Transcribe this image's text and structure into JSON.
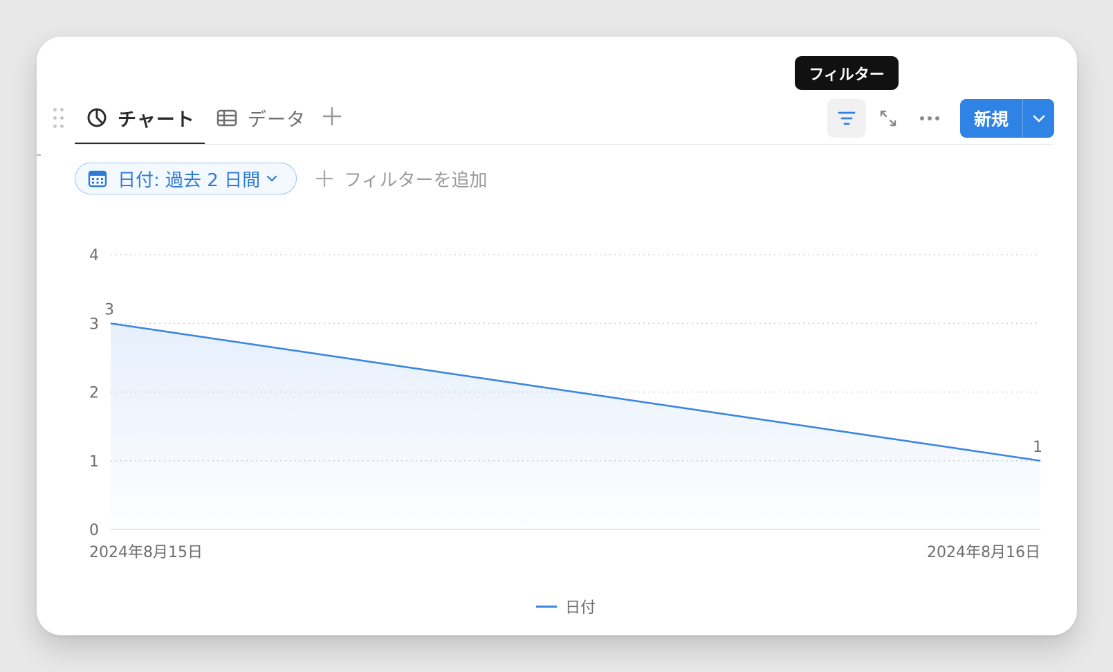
{
  "tabs": [
    {
      "label": "チャート",
      "icon": "pie-chart-icon",
      "active": true
    },
    {
      "label": "データ",
      "icon": "table-icon",
      "active": false
    }
  ],
  "tooltip": "フィルター",
  "toolbar": {
    "new_label": "新規",
    "icons": [
      "filter-icon",
      "expand-icon",
      "more-icon",
      "chevron-down-icon"
    ]
  },
  "filters": {
    "chip_label": "日付: 過去 2 日間",
    "add_filter_label": "フィルターを追加"
  },
  "colors": {
    "accent": "#2f83e4",
    "line": "#3b86e0"
  },
  "chart_data": {
    "type": "area",
    "x": [
      "2024年8月15日",
      "2024年8月16日"
    ],
    "series": [
      {
        "name": "日付",
        "values": [
          3,
          1
        ]
      }
    ],
    "yticks": [
      0,
      1,
      2,
      3,
      4
    ],
    "ylim": [
      0,
      4
    ],
    "data_labels": [
      "3",
      "1"
    ],
    "grid": true,
    "legend": "bottom-center"
  }
}
